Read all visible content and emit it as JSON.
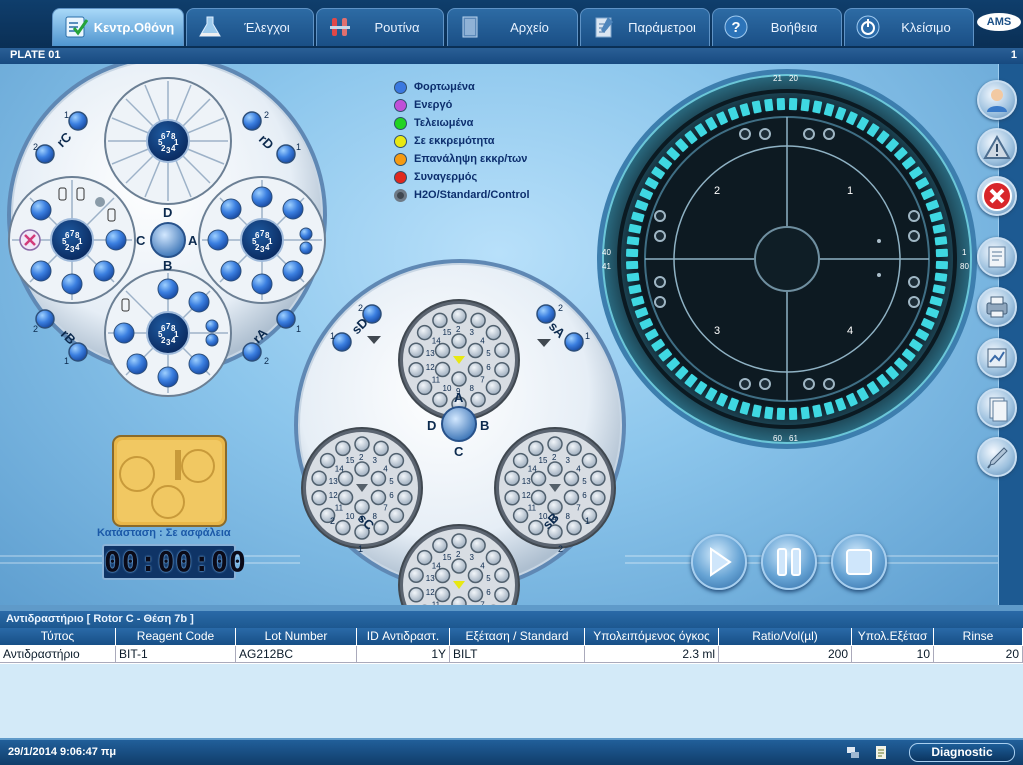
{
  "tabs": [
    {
      "label": "Κεντρ.Οθόνη",
      "icon": "checklist-icon",
      "active": true
    },
    {
      "label": "Έλεγχοι",
      "icon": "flask-icon"
    },
    {
      "label": "Ρουτίνα",
      "icon": "test-tubes-icon"
    },
    {
      "label": "Αρχείο",
      "icon": "book-icon"
    },
    {
      "label": "Παράμετροι",
      "icon": "clipboard-icon"
    },
    {
      "label": "Βοήθεια",
      "icon": "help-icon"
    },
    {
      "label": "Κλείσιμο",
      "icon": "power-icon"
    }
  ],
  "logo": "AMS",
  "plate": {
    "title": "PLATE 01",
    "number": "1"
  },
  "legend": [
    {
      "label": "Φορτωμένα",
      "color": "#3a78e0"
    },
    {
      "label": "Ενεργό",
      "color": "#c050d8"
    },
    {
      "label": "Τελειωμένα",
      "color": "#22d322"
    },
    {
      "label": "Σε εκκρεμότητα",
      "color": "#e8e812"
    },
    {
      "label": "Επανάληψη εκκρ/των",
      "color": "#f59a12"
    },
    {
      "label": "Συναγερμός",
      "color": "#e0281e"
    },
    {
      "label": "H2O/Standard/Control",
      "color": "#404850"
    }
  ],
  "reagent_rotor": {
    "center_letters": {
      "top": "D",
      "left": "C",
      "right": "A",
      "bottom": "B"
    },
    "quadrant_labels": [
      "rC",
      "rD",
      "rB",
      "rA"
    ],
    "pos_numbers": [
      "1",
      "2"
    ],
    "hub_numbers": [
      "6",
      "7",
      "8",
      "5",
      "1",
      "2",
      "4",
      "3"
    ]
  },
  "sample_rotor": {
    "center_letters": {
      "top": "A",
      "left": "D",
      "right": "B",
      "bottom": "C"
    },
    "quadrant_labels": [
      "sD",
      "sA",
      "sC",
      "sB"
    ],
    "pos_numbers": [
      "1",
      "2"
    ],
    "tray_numbers": [
      "2",
      "3",
      "4",
      "5",
      "6",
      "7",
      "8",
      "9",
      "10",
      "11",
      "12",
      "13",
      "14",
      "15"
    ]
  },
  "cuvette_rotor": {
    "inner_numbers": [
      "2",
      "1",
      "3",
      "4"
    ],
    "edge_numbers": [
      "21",
      "20",
      "40",
      "41",
      "1",
      "80",
      "60",
      "61"
    ]
  },
  "status_caption": "Κατάσταση : Σε ασφάλεια",
  "timer": "00:00:00",
  "side_buttons": [
    "operator-icon",
    "warning-icon",
    "stop-icon",
    "report-icon",
    "printer-icon",
    "graph-icon",
    "document-icon",
    "pipette-icon"
  ],
  "controls": [
    "play",
    "pause",
    "stop"
  ],
  "info": {
    "title": "Αντιδραστήριο   [ Rotor C - Θέση 7b ]",
    "columns": [
      "Τύπος",
      "Reagent Code",
      "Lot Number",
      "ID Αντιδραστ.",
      "Εξέταση / Standard",
      "Υπολειπόμενος όγκος",
      "Ratio/Vol(µl)",
      "Υπολ.Εξέτασ",
      "Rinse"
    ],
    "rows": [
      [
        "Αντιδραστήριο",
        "BIT-1",
        "AG212BC",
        "1Y",
        "BILT",
        "2.3 ml",
        "200",
        "10",
        "20"
      ]
    ]
  },
  "statusbar": {
    "datetime": "29/1/2014  9:06:47 πμ",
    "diagnostic": "Diagnostic"
  }
}
